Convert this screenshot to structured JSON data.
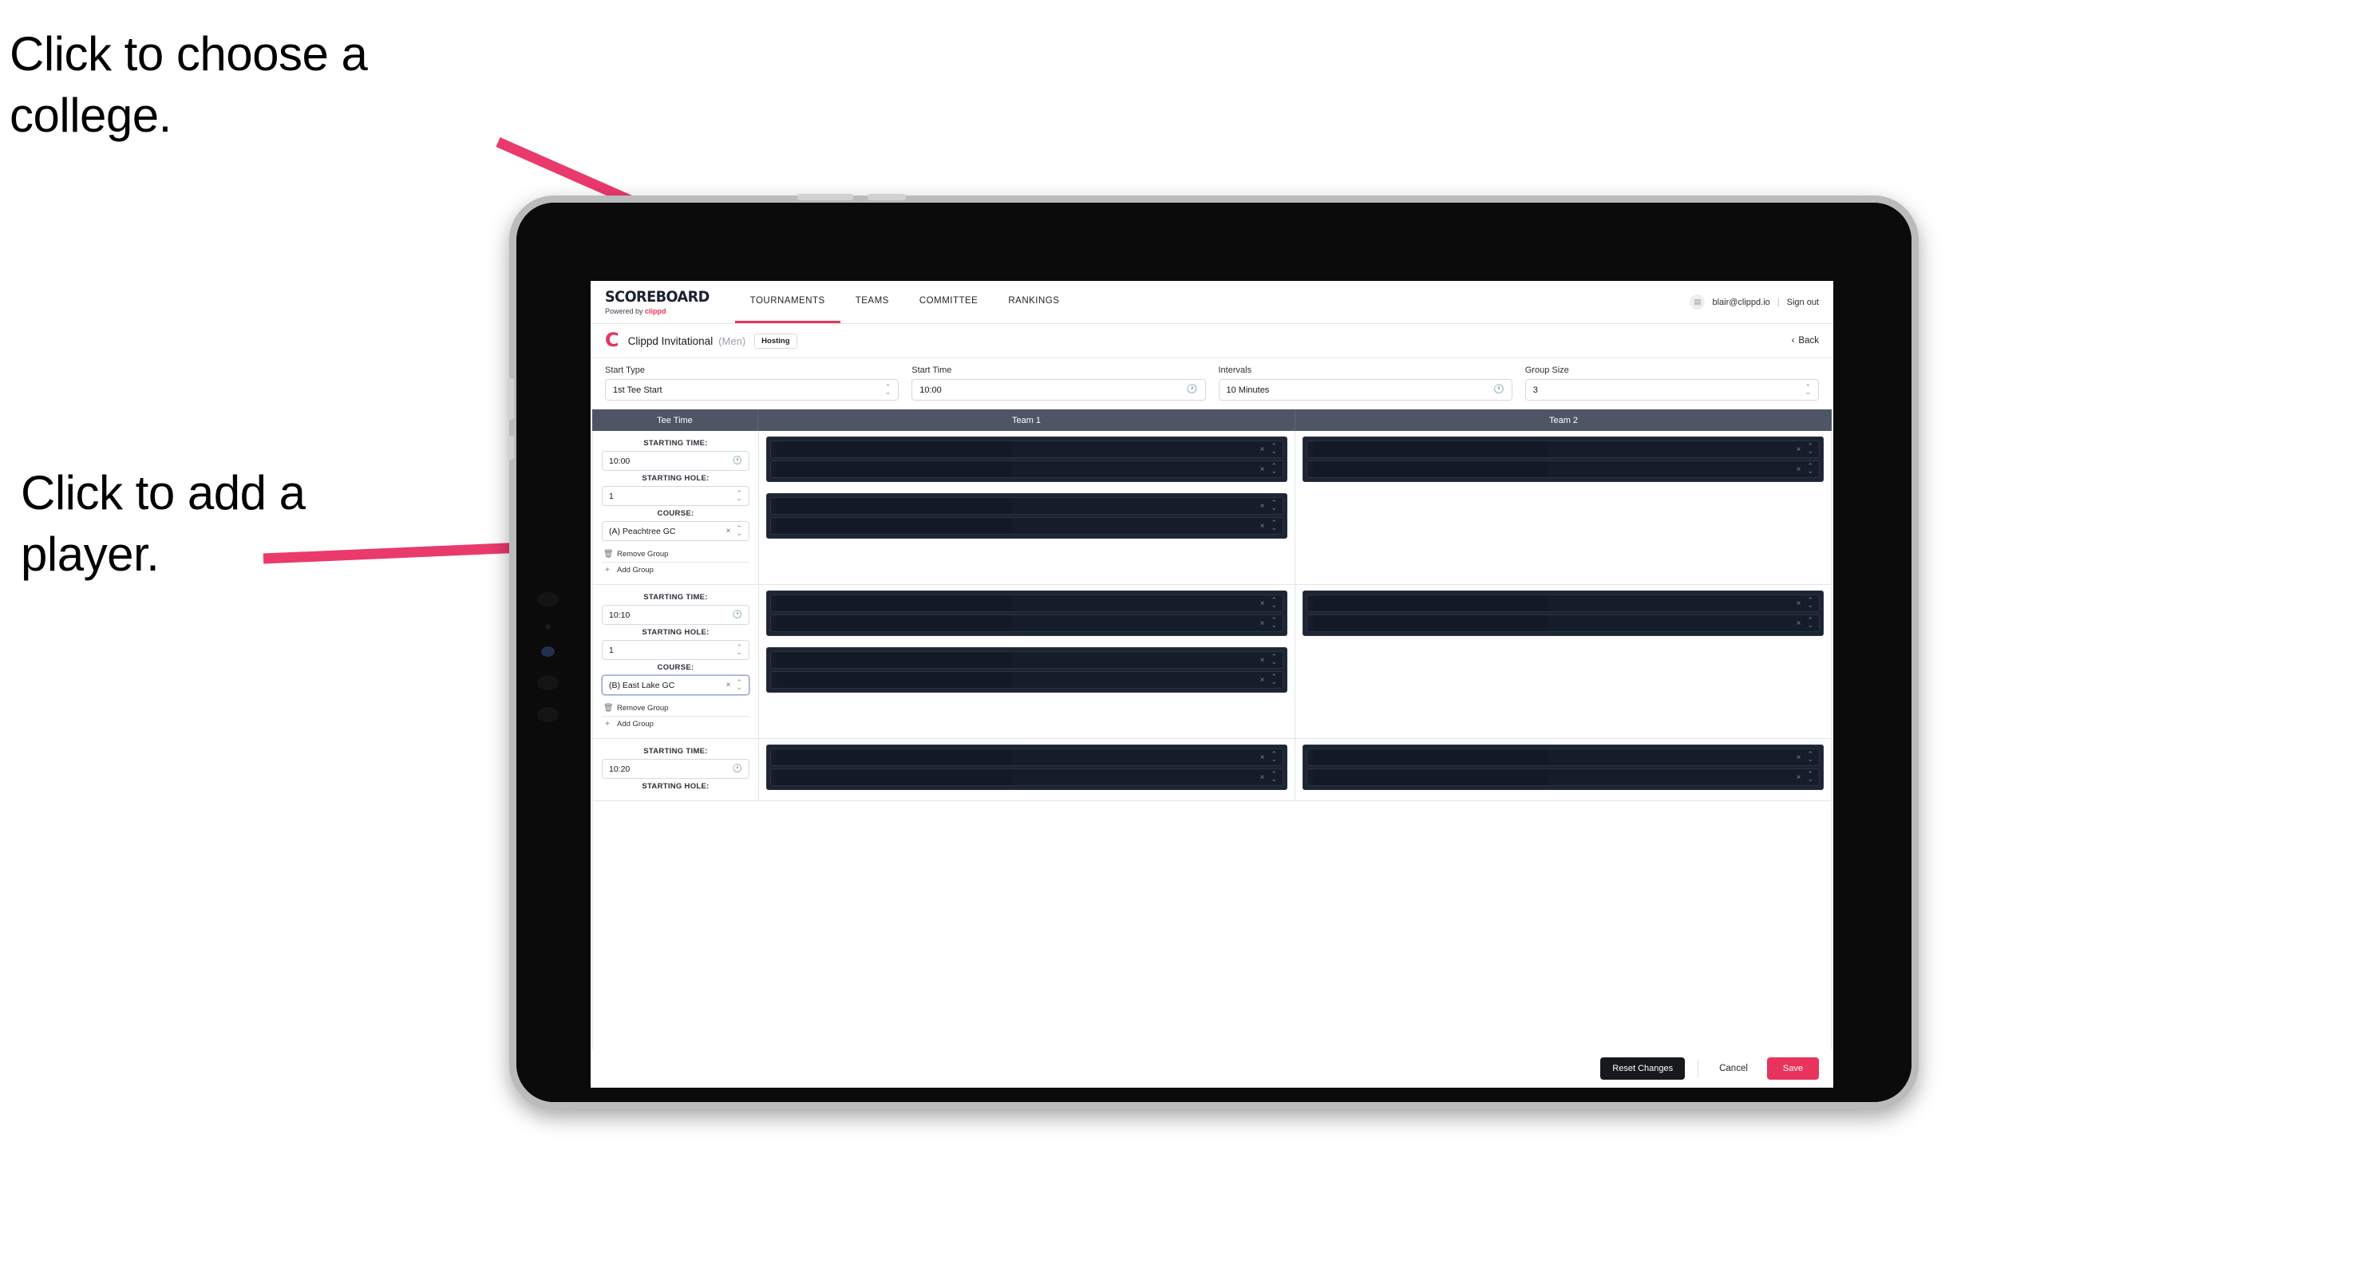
{
  "annotations": [
    {
      "id": "choose-college",
      "text": "Click to choose a college."
    },
    {
      "id": "add-player",
      "text": "Click to add a player."
    }
  ],
  "colors": {
    "accent": "#e8335c",
    "header_bar": "#4e5666",
    "group_box": "#1d2533",
    "player_row": "#161d2a",
    "dark_button": "#17191c"
  },
  "topnav": {
    "brand_word": "SCOREBOARD",
    "brand_prefix": "Powered by",
    "brand_clippd": "clippd",
    "items": [
      {
        "label": "TOURNAMENTS",
        "active": true
      },
      {
        "label": "TEAMS",
        "active": false
      },
      {
        "label": "COMMITTEE",
        "active": false
      },
      {
        "label": "RANKINGS",
        "active": false
      }
    ],
    "avatar_glyph": "▤",
    "email": "blair@clippd.io",
    "separator": "|",
    "signout": "Sign out"
  },
  "tournament_bar": {
    "logo_letter": "C",
    "name": "Clippd Invitational",
    "gender": "(Men)",
    "status_pill": "Hosting",
    "back_chevron": "‹",
    "back_label": "Back"
  },
  "controls": [
    {
      "label": "Start Type",
      "value": "1st Tee Start",
      "icon": "stepper"
    },
    {
      "label": "Start Time",
      "value": "10:00",
      "icon": "clock"
    },
    {
      "label": "Intervals",
      "value": "10 Minutes",
      "icon": "clock"
    },
    {
      "label": "Group Size",
      "value": "3",
      "icon": "stepper"
    }
  ],
  "table": {
    "headers": [
      "Tee Time",
      "Team 1",
      "Team 2"
    ],
    "labels": {
      "starting_time": "STARTING TIME:",
      "starting_hole": "STARTING HOLE:",
      "course": "COURSE:",
      "remove_group": "Remove Group",
      "add_group": "Add Group",
      "remove_icon": "🗑",
      "add_icon": "+",
      "clear_icon": "×"
    },
    "rows": [
      {
        "starting_time": "10:00",
        "starting_hole": "1",
        "course": "(A) Peachtree GC",
        "course_focused": false,
        "team1_groups": [
          {
            "players": [
              "",
              ""
            ]
          },
          {
            "players": [
              "",
              ""
            ]
          }
        ],
        "team2_groups": [
          {
            "players": [
              "",
              ""
            ]
          }
        ]
      },
      {
        "starting_time": "10:10",
        "starting_hole": "1",
        "course": "(B) East Lake GC",
        "course_focused": true,
        "team1_groups": [
          {
            "players": [
              "",
              ""
            ]
          },
          {
            "players": [
              "",
              ""
            ]
          }
        ],
        "team2_groups": [
          {
            "players": [
              "",
              ""
            ]
          }
        ]
      },
      {
        "starting_time": "10:20",
        "starting_hole": "",
        "course": "",
        "course_focused": false,
        "partial": true,
        "team1_groups": [
          {
            "players": [
              "",
              ""
            ]
          }
        ],
        "team2_groups": [
          {
            "players": [
              "",
              ""
            ]
          }
        ]
      }
    ]
  },
  "footer": {
    "reset_label": "Reset Changes",
    "cancel_label": "Cancel",
    "save_label": "Save"
  }
}
